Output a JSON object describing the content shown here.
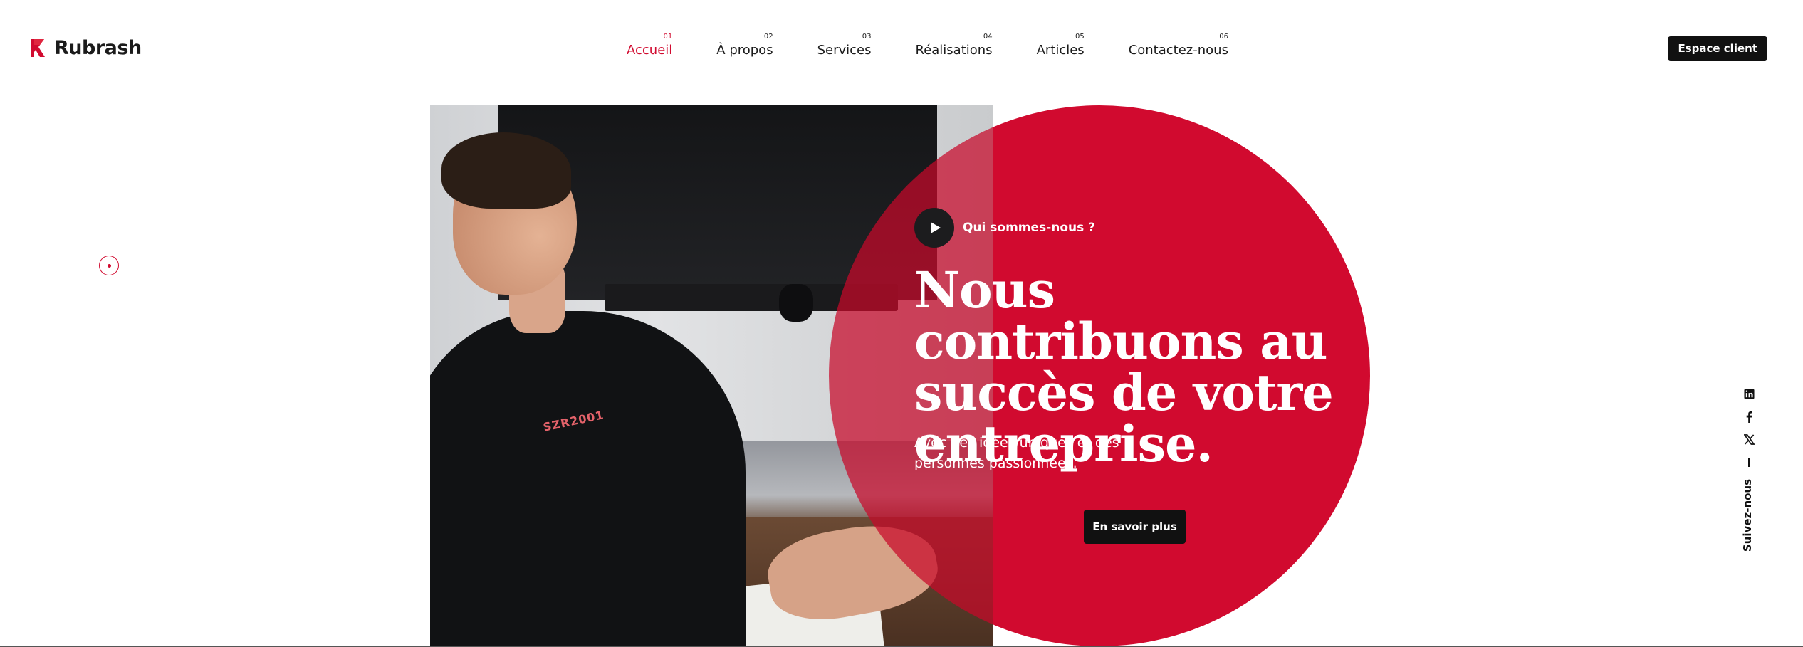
{
  "brand": {
    "name": "Rubrash",
    "accent_color": "#d10a2f"
  },
  "nav": {
    "items": [
      {
        "num": "01",
        "label": "Accueil",
        "active": true
      },
      {
        "num": "02",
        "label": "À propos"
      },
      {
        "num": "03",
        "label": "Services"
      },
      {
        "num": "04",
        "label": "Réalisations"
      },
      {
        "num": "05",
        "label": "Articles"
      },
      {
        "num": "06",
        "label": "Contactez-nous"
      }
    ]
  },
  "header": {
    "client_button": "Espace client"
  },
  "hero": {
    "video_label": "Qui sommes-nous ?",
    "headline": "Nous contribuons au succès de votre entreprise.",
    "subtitle": "Avec des idées uniques et des personnes passionnées.",
    "cta_label": "En savoir plus",
    "image_shirt_text": "SZR2001",
    "circle_color": "#d10a2f"
  },
  "social": {
    "label": "Suivez-nous",
    "icons": [
      "linkedin-icon",
      "facebook-icon",
      "x-icon"
    ]
  }
}
